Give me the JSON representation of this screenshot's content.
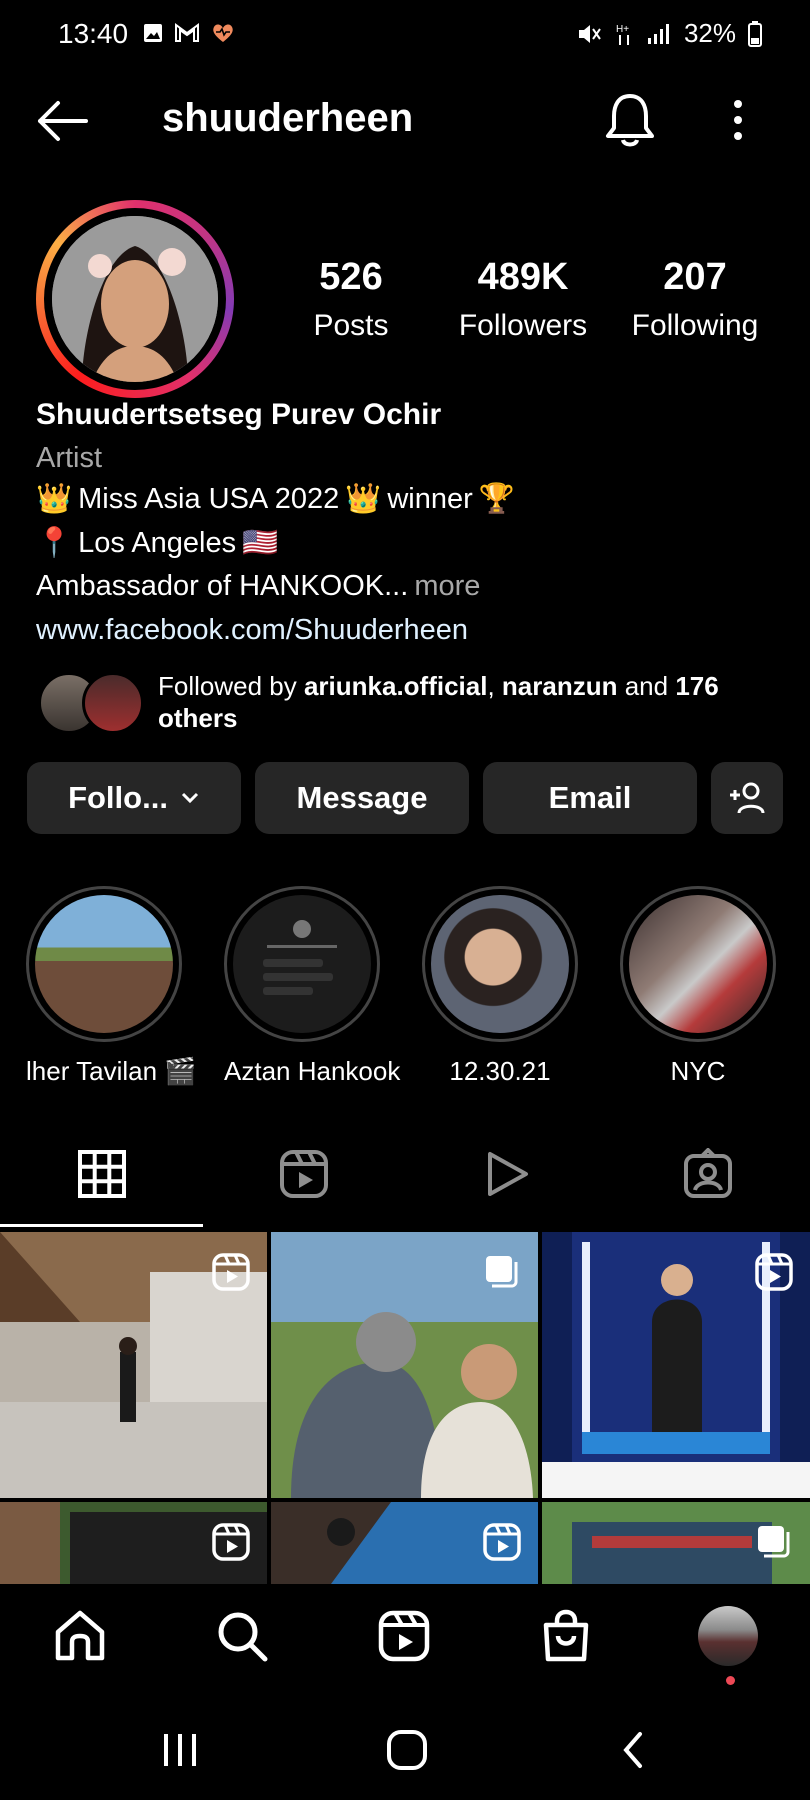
{
  "status_bar": {
    "time": "13:40",
    "battery": "32%"
  },
  "header": {
    "username": "shuuderheen"
  },
  "stats": [
    {
      "value": "526",
      "label": "Posts"
    },
    {
      "value": "489K",
      "label": "Followers"
    },
    {
      "value": "207",
      "label": "Following"
    }
  ],
  "profile": {
    "full_name": "Shuudertsetseg Purev Ochir",
    "category": "Artist",
    "bio_line1": "Miss Asia USA 2022",
    "bio_line1_suffix": "winner",
    "bio_line2": "Los Angeles",
    "bio_line3": "Ambassador of HANKOOK...",
    "bio_more": "more",
    "link": "www.facebook.com/Shuuderheen"
  },
  "followed_by": {
    "prefix": "Followed by ",
    "user1": "ariunka.official",
    "separator": ", ",
    "user2": "naranzun",
    "and": " and ",
    "others": "176 others"
  },
  "buttons": {
    "follow": "Follo...",
    "message": "Message",
    "email": "Email"
  },
  "highlights": [
    {
      "label": "lher Tavilan 🎬"
    },
    {
      "label": "Aztan Hankook"
    },
    {
      "label": "12.30.21"
    },
    {
      "label": "NYC"
    }
  ],
  "colors": {
    "background": "#000000",
    "button_bg": "#262626",
    "notification_dot": "#ed4956",
    "muted_text": "#a8a8a8"
  }
}
